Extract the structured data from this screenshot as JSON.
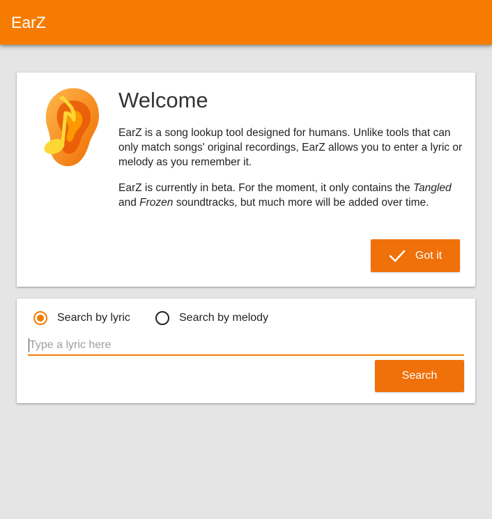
{
  "appbar": {
    "title": "EarZ"
  },
  "welcome": {
    "heading": "Welcome",
    "para1": "EarZ is a song lookup tool designed for humans. Unlike tools that can only match songs' original recordings, EarZ allows you to enter a lyric or melody as you remember it.",
    "para2_start": "EarZ is currently in beta. For the moment, it only contains the ",
    "para2_em1": "Tangled",
    "para2_mid": " and ",
    "para2_em2": "Frozen",
    "para2_end": " soundtracks, but much more will be added over time.",
    "got_it_label": "Got it",
    "logo_icon": "ear-music-note-icon",
    "check_icon": "checkmark-icon"
  },
  "search": {
    "radio_lyric_label": "Search by lyric",
    "radio_melody_label": "Search by melody",
    "selected_mode": "lyric",
    "input_value": "",
    "input_placeholder": "Type a lyric here",
    "search_label": "Search"
  },
  "colors": {
    "accent": "#f57c00",
    "button": "#f0700a",
    "background": "#e5e5e5"
  }
}
